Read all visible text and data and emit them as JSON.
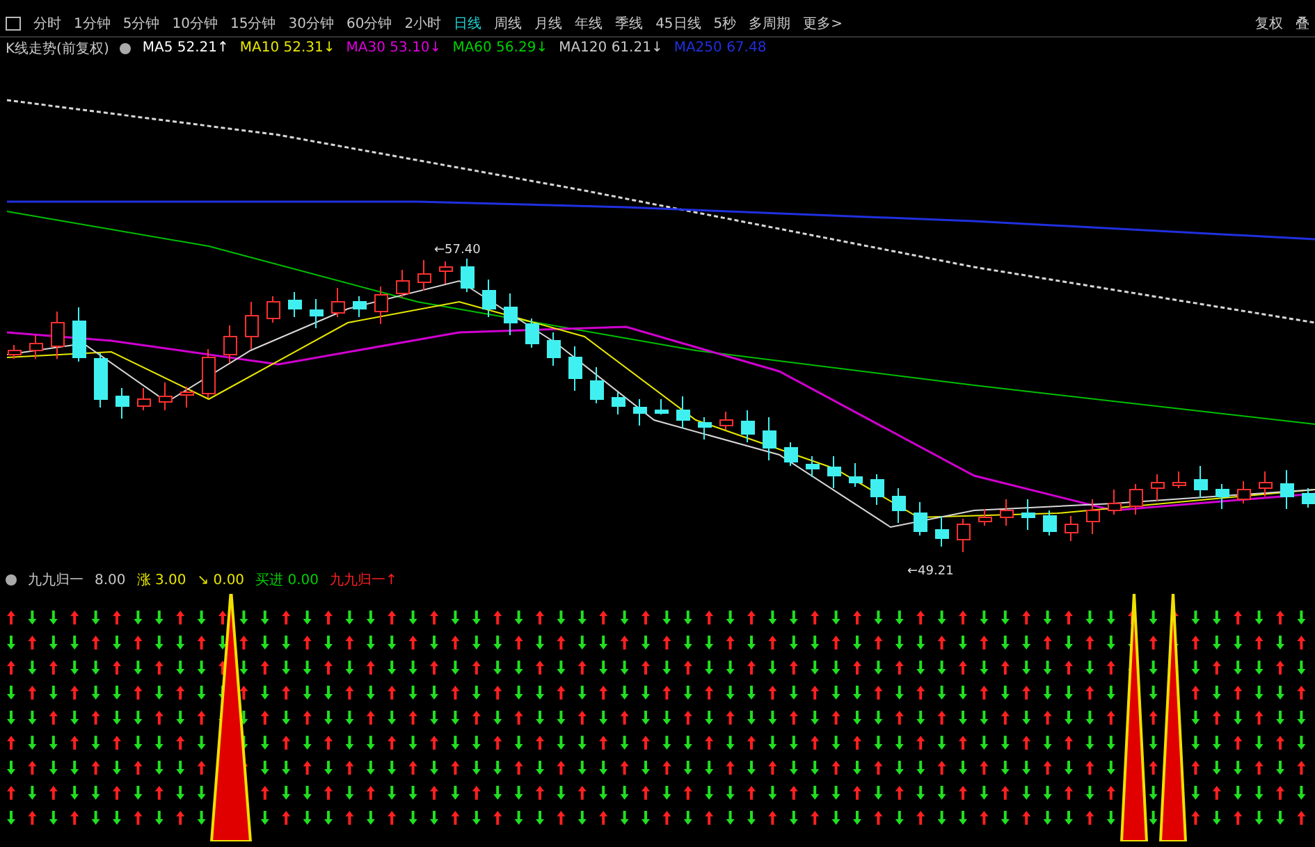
{
  "toolbar": {
    "periods": [
      {
        "label": "分时",
        "selected": false
      },
      {
        "label": "1分钟",
        "selected": false
      },
      {
        "label": "5分钟",
        "selected": false
      },
      {
        "label": "10分钟",
        "selected": false
      },
      {
        "label": "15分钟",
        "selected": false
      },
      {
        "label": "30分钟",
        "selected": false
      },
      {
        "label": "60分钟",
        "selected": false
      },
      {
        "label": "2小时",
        "selected": false
      },
      {
        "label": "日线",
        "selected": true
      },
      {
        "label": "周线",
        "selected": false
      },
      {
        "label": "月线",
        "selected": false
      },
      {
        "label": "年线",
        "selected": false
      },
      {
        "label": "季线",
        "selected": false
      },
      {
        "label": "45日线",
        "selected": false
      },
      {
        "label": "5秒",
        "selected": false
      },
      {
        "label": "多周期",
        "selected": false
      },
      {
        "label": "更多>",
        "selected": false
      }
    ],
    "right": [
      "复权",
      "叠"
    ]
  },
  "main_legend": {
    "title": "K线走势(前复权)",
    "items": [
      {
        "label": "MA5",
        "value": "52.21↑",
        "color": "#ffffff"
      },
      {
        "label": "MA10",
        "value": "52.31↓",
        "color": "#e8e800"
      },
      {
        "label": "MA30",
        "value": "53.10↓",
        "color": "#e000e0"
      },
      {
        "label": "MA60",
        "value": "56.29↓",
        "color": "#00d000"
      },
      {
        "label": "MA120",
        "value": "61.21↓",
        "color": "#c8c8c8"
      },
      {
        "label": "MA250",
        "value": "67.48",
        "color": "#2030e0"
      }
    ]
  },
  "price_labels": [
    "←57.40",
    "←49.21"
  ],
  "indicator_legend": {
    "title": "九九归一",
    "items": [
      {
        "value": "8.00",
        "color": "#c8c8c8"
      },
      {
        "label": "涨",
        "value": "3.00",
        "color": "#e8e800"
      },
      {
        "label": "↘",
        "value": "0.00",
        "color": "#e8e800"
      },
      {
        "label": "买进",
        "value": "0.00",
        "color": "#00d000"
      },
      {
        "label": "九九归一↑",
        "color": "#ff2020"
      }
    ]
  }
}
